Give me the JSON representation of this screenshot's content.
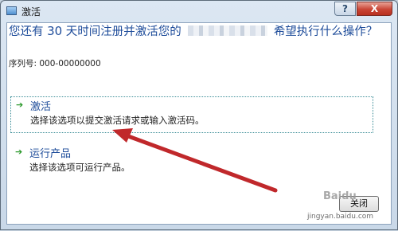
{
  "window": {
    "title": "激活",
    "help_label": "?",
    "close_label": "X"
  },
  "heading": {
    "prefix": "您还有 ",
    "days": "30",
    "middle": " 天时间注册并激活您的",
    "suffix": "希望执行什么操作？"
  },
  "serial": {
    "label": "序列号: 000-00000000"
  },
  "options": [
    {
      "title": "激活",
      "description": "选择该选项以提交激活请求或输入激活码。"
    },
    {
      "title": "运行产品",
      "description": "选择该选项可运行产品。"
    }
  ],
  "bottom_button": {
    "label": "关闭"
  },
  "watermark": {
    "brand": "Baidu",
    "site": "jingyan.baidu.com"
  },
  "colors": {
    "heading": "#1e4c9a",
    "arrow_annotation": "#c0282b",
    "option_arrow": "#2e9a2e"
  },
  "icons": {
    "title": "window-app-icon",
    "option": "green-arrow-icon"
  }
}
